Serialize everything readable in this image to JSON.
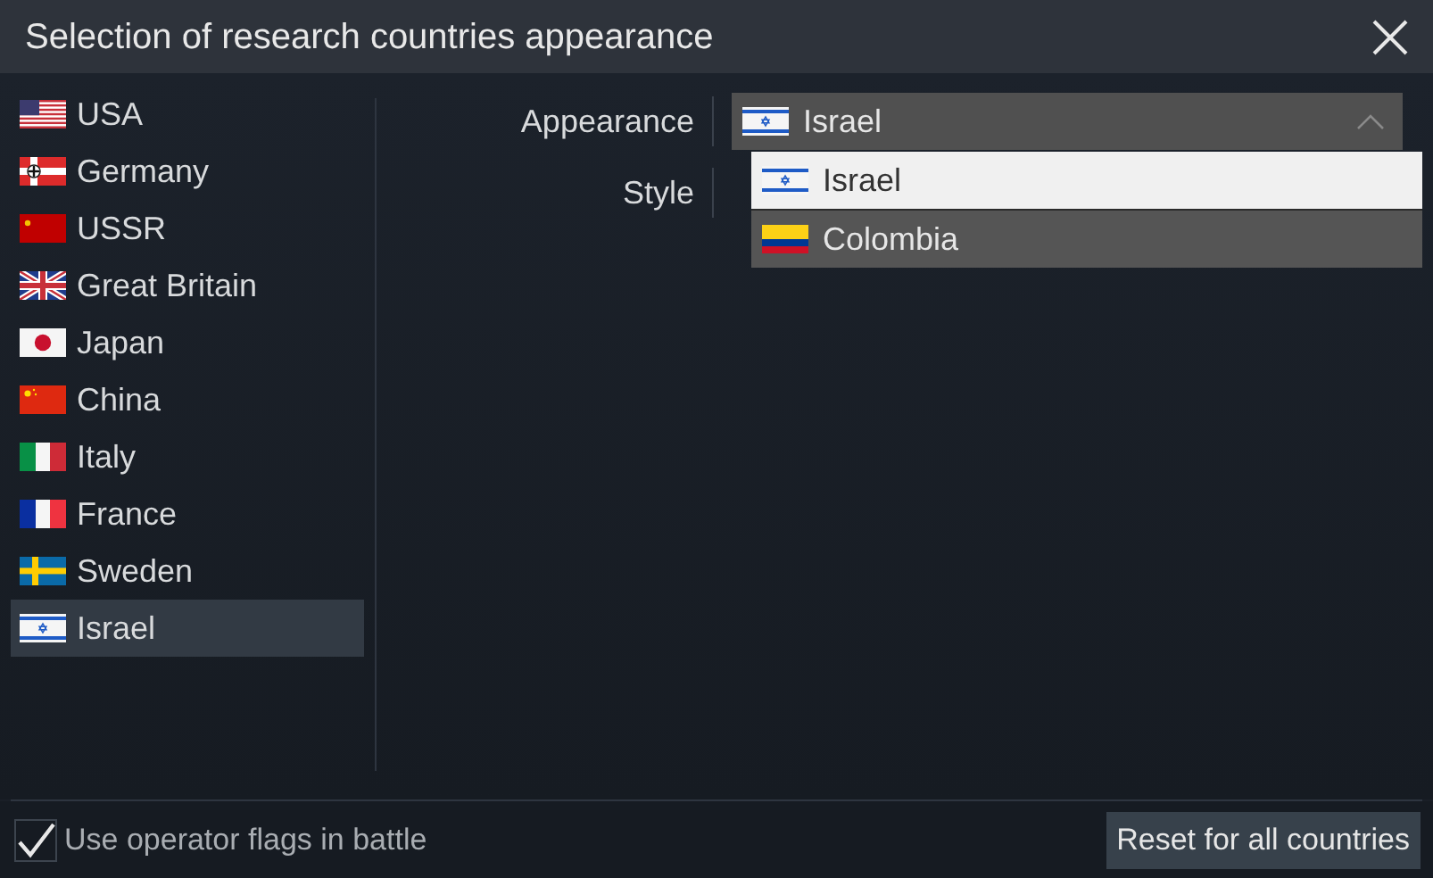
{
  "window": {
    "title": "Selection of research countries appearance"
  },
  "countries": [
    {
      "label": "USA",
      "kind": "usa",
      "selected": false
    },
    {
      "label": "Germany",
      "kind": "germany",
      "selected": false
    },
    {
      "label": "USSR",
      "kind": "ussr",
      "selected": false
    },
    {
      "label": "Great Britain",
      "kind": "britain",
      "selected": false
    },
    {
      "label": "Japan",
      "kind": "japan",
      "selected": false
    },
    {
      "label": "China",
      "kind": "china",
      "selected": false
    },
    {
      "label": "Italy",
      "kind": "italy",
      "selected": false
    },
    {
      "label": "France",
      "kind": "france",
      "selected": false
    },
    {
      "label": "Sweden",
      "kind": "sweden",
      "selected": false
    },
    {
      "label": "Israel",
      "kind": "israel",
      "selected": true
    }
  ],
  "appearance": {
    "label": "Appearance",
    "value": "Israel",
    "kind": "israel",
    "expanded": true,
    "options": [
      {
        "label": "Israel",
        "kind": "israel",
        "selected": true
      },
      {
        "label": "Colombia",
        "kind": "colombia",
        "selected": false
      }
    ]
  },
  "style": {
    "label": "Style"
  },
  "footer": {
    "checkbox": {
      "label": "Use operator flags in battle",
      "checked": true
    },
    "reset_button": "Reset for all countries"
  }
}
